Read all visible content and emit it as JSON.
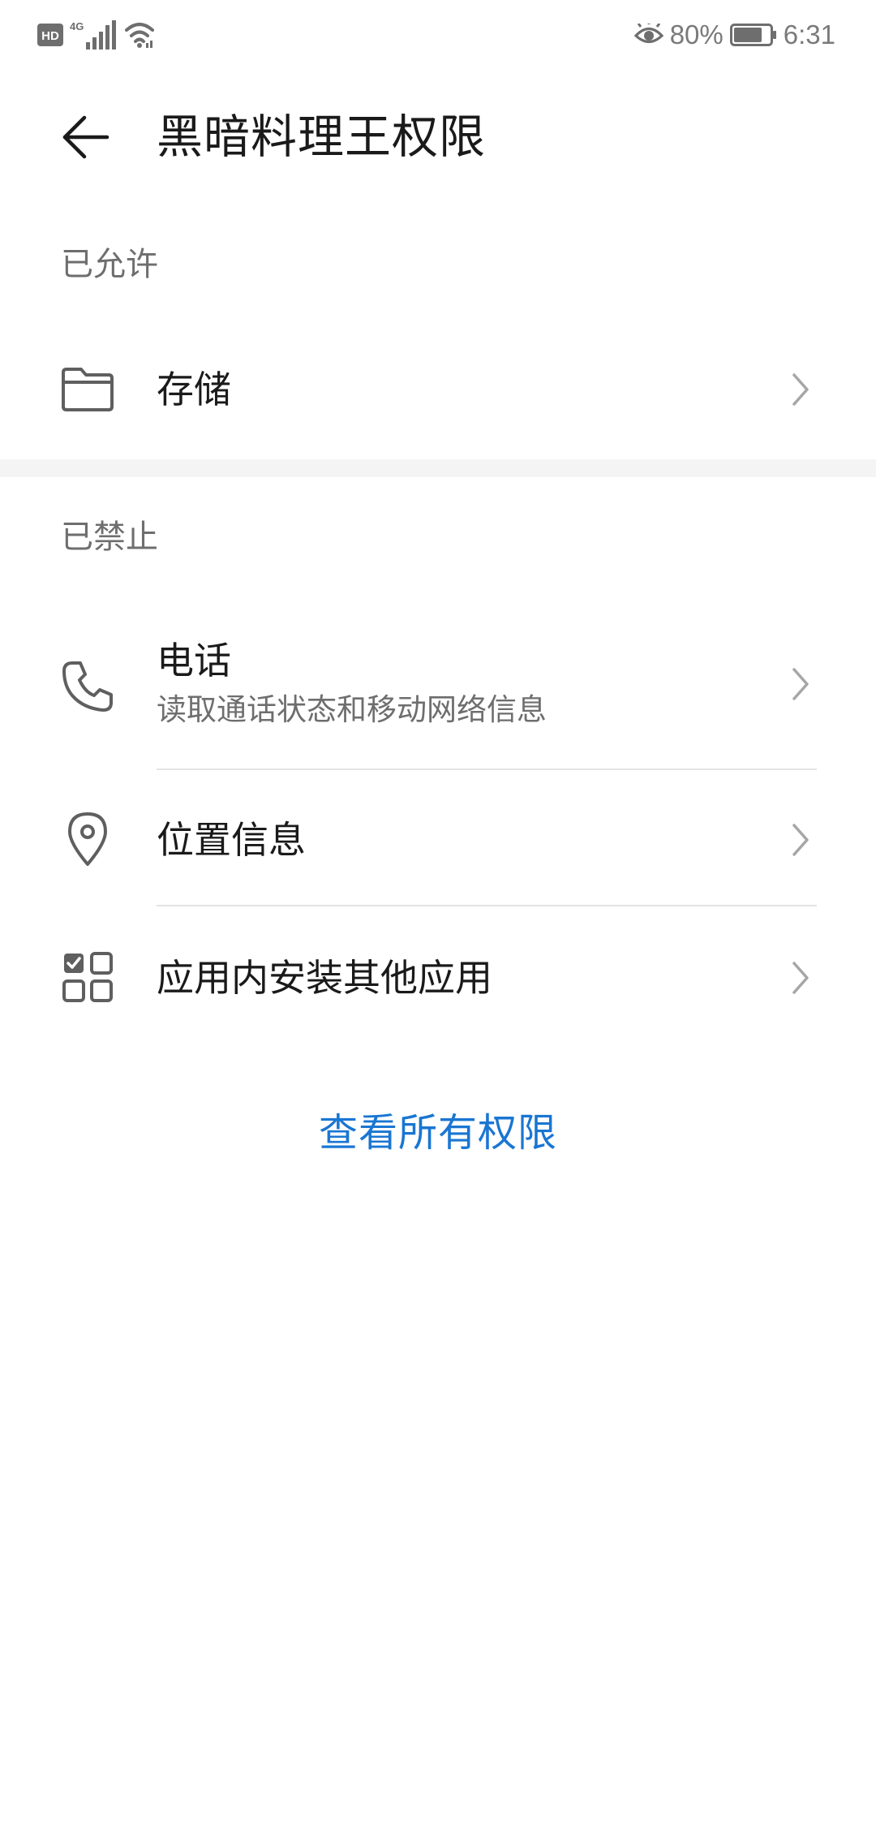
{
  "status_bar": {
    "hd_label": "HD",
    "network_label": "4G",
    "battery_percent": "80%",
    "battery_level": 0.8,
    "time": "6:31"
  },
  "header": {
    "back_icon": "back-arrow-icon",
    "title": "黑暗料理王权限"
  },
  "allowed": {
    "header": "已允许",
    "items": [
      {
        "label": "存储",
        "icon": "folder-icon"
      }
    ]
  },
  "denied": {
    "header": "已禁止",
    "items": [
      {
        "label": "电话",
        "sublabel": "读取通话状态和移动网络信息",
        "icon": "phone-icon"
      },
      {
        "label": "位置信息",
        "icon": "location-pin-icon"
      },
      {
        "label": "应用内安装其他应用",
        "icon": "app-grid-icon"
      }
    ]
  },
  "view_all_label": "查看所有权限",
  "colors": {
    "accent": "#1a76d2",
    "text_primary": "#1a1a1a",
    "text_secondary": "#6e6e6e",
    "divider": "#e3e3e3",
    "section_gap": "#f4f4f4"
  }
}
